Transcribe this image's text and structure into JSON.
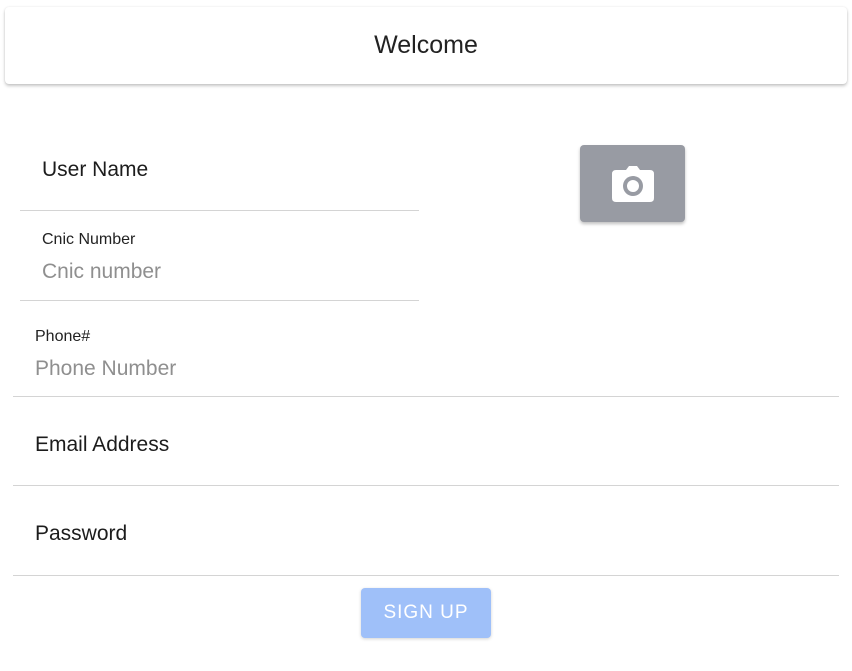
{
  "header": {
    "title": "Welcome"
  },
  "form": {
    "username": {
      "label": "User Name"
    },
    "cnic": {
      "label": "Cnic Number",
      "placeholder": "Cnic number",
      "value": ""
    },
    "phone": {
      "label": "Phone#",
      "placeholder": "Phone Number",
      "value": ""
    },
    "email": {
      "label": "Email Address"
    },
    "password": {
      "label": "Password"
    }
  },
  "photo_button": {
    "icon": "camera-icon"
  },
  "signup_button": {
    "label": "SIGN UP"
  },
  "colors": {
    "camera_button_bg": "#989ba3",
    "signup_button_bg": "#9fc0f9",
    "divider": "#d4d4d4",
    "placeholder_text": "#8f8f8f"
  }
}
